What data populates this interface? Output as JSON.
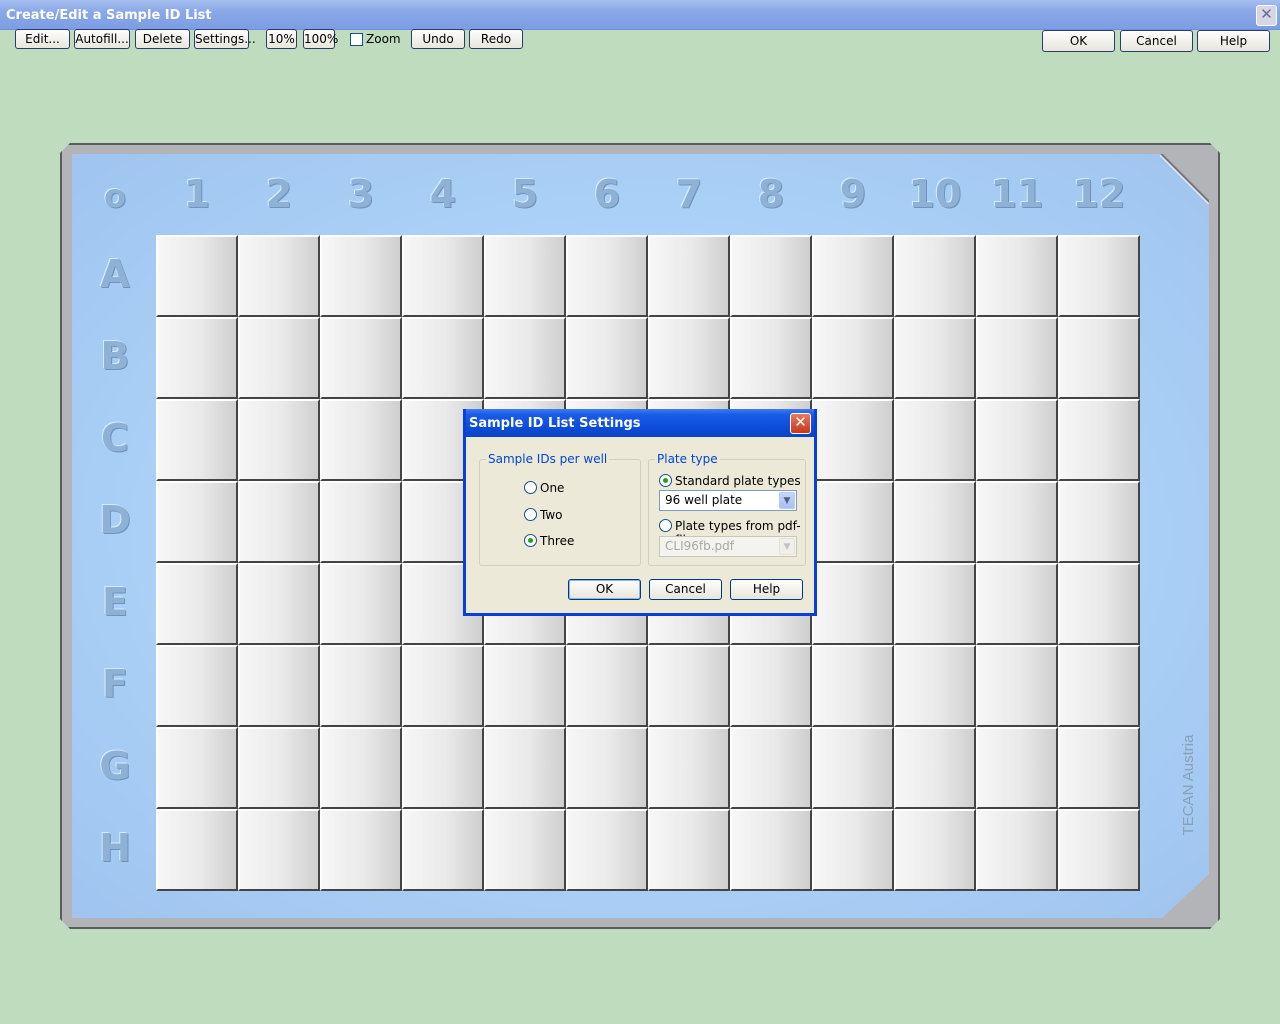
{
  "window": {
    "title": "Create/Edit a Sample ID List"
  },
  "toolbar": {
    "edit": "Edit...",
    "autofill": "Autofill...",
    "delete": "Delete",
    "settings": "Settings...",
    "zoom10": "10%",
    "zoom100": "100%",
    "zoom_label": "Zoom",
    "zoom_checked": false,
    "undo": "Undo",
    "redo": "Redo",
    "ok": "OK",
    "cancel": "Cancel",
    "help": "Help"
  },
  "plate": {
    "corner": "o",
    "columns": [
      "1",
      "2",
      "3",
      "4",
      "5",
      "6",
      "7",
      "8",
      "9",
      "10",
      "11",
      "12"
    ],
    "rows": [
      "A",
      "B",
      "C",
      "D",
      "E",
      "F",
      "G",
      "H"
    ],
    "brand": "TECAN Austria"
  },
  "dialog": {
    "title": "Sample ID List Settings",
    "ids_group": "Sample IDs per well",
    "ids_options": [
      "One",
      "Two",
      "Three"
    ],
    "ids_selected": "Three",
    "plate_group": "Plate type",
    "standard_label": "Standard plate types",
    "standard_value": "96 well plate",
    "pdf_label": "Plate types from pdf-file",
    "pdf_value": "CLI96fb.pdf",
    "plate_selected": "Standard plate types",
    "ok": "OK",
    "cancel": "Cancel",
    "help": "Help"
  },
  "colors": {
    "background": "#bfdcbf",
    "dialog_title": "#0a4bd8",
    "plate": "#acd2f8"
  }
}
